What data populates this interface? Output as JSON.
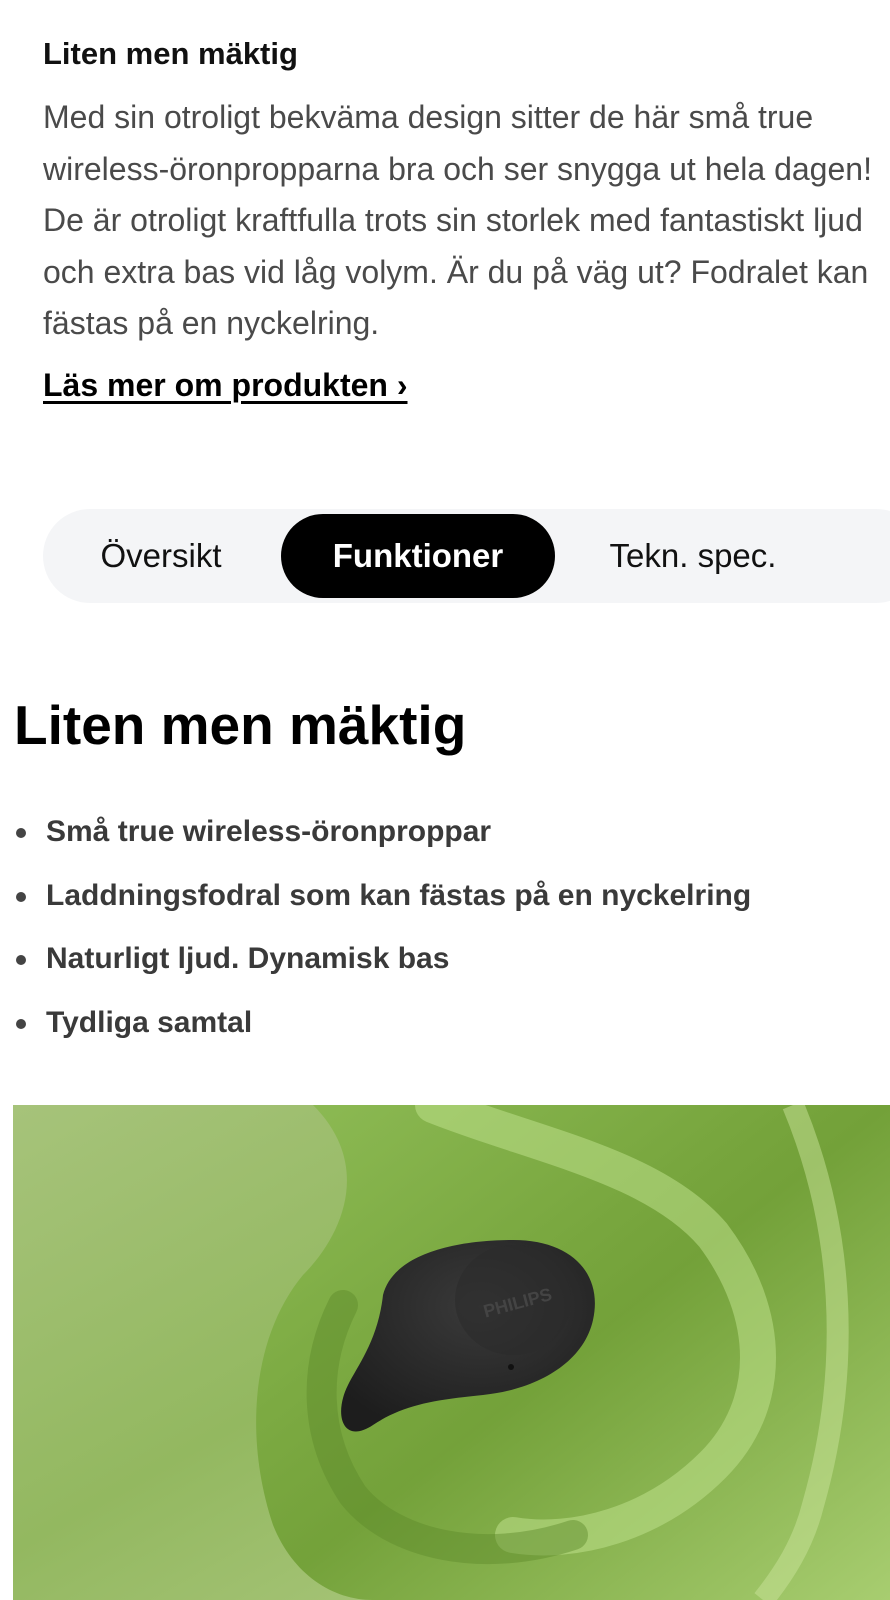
{
  "intro": {
    "title": "Liten men mäktig",
    "body": "Med sin otroligt bekväma design sitter de här små true wireless-öronpropparna bra och ser snygga ut hela dagen! De är otroligt kraftfulla trots sin storlek med fantastiskt ljud och extra bas vid låg volym. Är du på väg ut? Fodralet kan fästas på en nyckelring.",
    "read_more": "Läs mer om produkten ›"
  },
  "tabs": [
    {
      "label": "Översikt",
      "active": false
    },
    {
      "label": "Funktioner",
      "active": true
    },
    {
      "label": "Tekn. spec.",
      "active": false
    }
  ],
  "features_section": {
    "title": "Liten men mäktig",
    "items": [
      "Små true wireless-öronproppar",
      "Laddningsfodral som kan fästas på en nyckelring",
      "Naturligt ljud. Dynamisk bas",
      "Tydliga samtal"
    ]
  },
  "hero_image": {
    "brand_mark": "PHILIPS",
    "colors": {
      "background": "#8fb45a",
      "earbud": "#2b2b2b"
    }
  }
}
